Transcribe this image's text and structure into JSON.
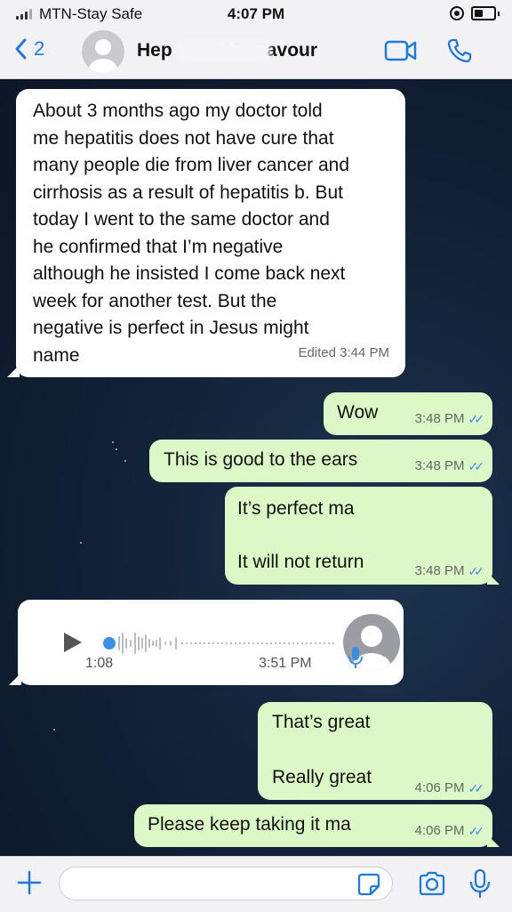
{
  "status_bar": {
    "carrier": "MTN-Stay Safe",
    "time": "4:07 PM"
  },
  "header": {
    "back_count": "2",
    "contact_name": "Hep          M   Favour"
  },
  "messages": [
    {
      "direction": "incoming",
      "text_lines": [
        "About 3 months ago my doctor told",
        "me hepatitis does not have cure that",
        "many people die from liver cancer and",
        "cirrhosis as a result of hepatitis b. But",
        "today I went to the same doctor and",
        "he confirmed that I’m negative",
        "although he insisted I come back next",
        "week for another test. But the",
        "negative is perfect in Jesus might",
        "name"
      ],
      "meta": "Edited 3:44 PM"
    },
    {
      "direction": "outgoing",
      "text": "Wow",
      "time": "3:48 PM"
    },
    {
      "direction": "outgoing",
      "text": "This is good to the ears",
      "time": "3:48 PM"
    },
    {
      "direction": "outgoing",
      "text_lines": [
        "It’s perfect ma",
        "It will not return"
      ],
      "time": "3:48 PM"
    },
    {
      "direction": "incoming",
      "type": "voice",
      "duration": "1:08",
      "time": "3:51 PM",
      "progress": 0
    },
    {
      "direction": "outgoing",
      "text_lines": [
        "That’s great",
        "Really great"
      ],
      "time": "4:06 PM"
    },
    {
      "direction": "outgoing",
      "text": "Please keep taking it ma",
      "time": "4:06 PM"
    }
  ],
  "input": {
    "placeholder": ""
  },
  "colors": {
    "accent": "#1f7ae0",
    "outgoing_bubble": "#dcf8c6",
    "incoming_bubble": "#ffffff",
    "read_ticks": "#3a8ee6"
  },
  "icons": [
    "signal-icon",
    "orientation-lock-icon",
    "battery-icon",
    "back-chevron-icon",
    "video-call-icon",
    "phone-call-icon",
    "play-icon",
    "mic-icon",
    "plus-icon",
    "sticker-icon",
    "camera-icon"
  ]
}
